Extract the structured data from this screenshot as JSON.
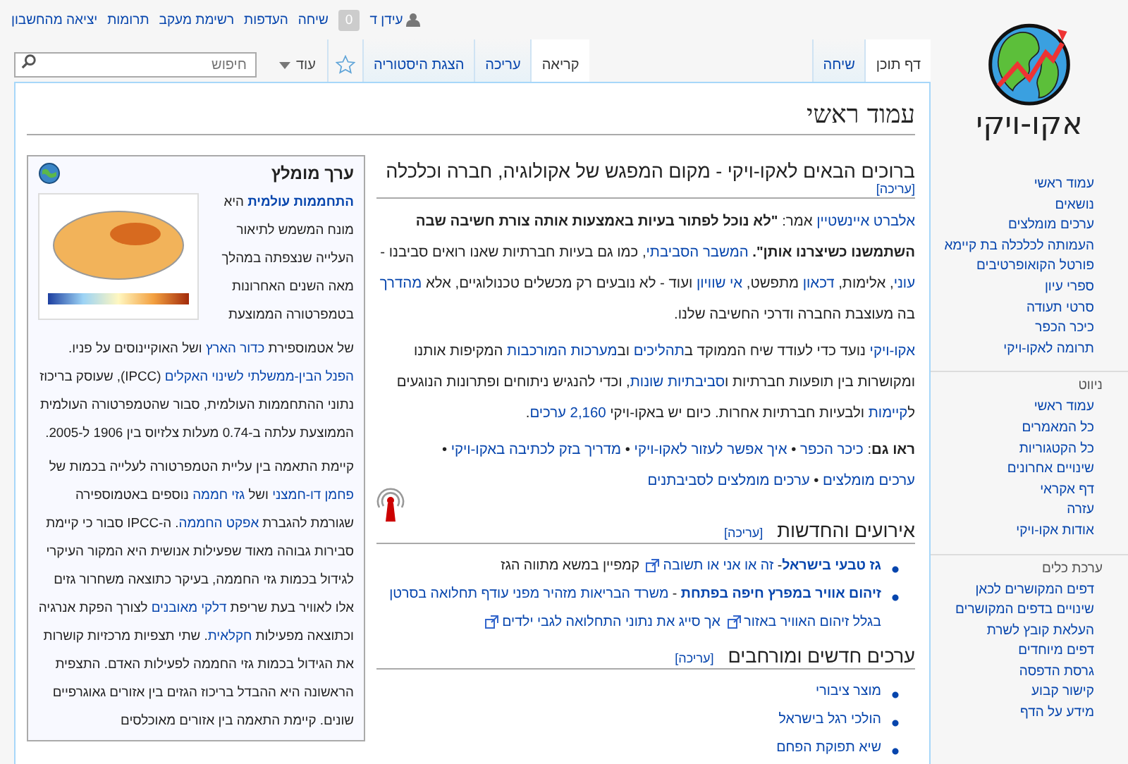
{
  "personal_bar": {
    "user": "עידן ד",
    "notifications": "0",
    "links": [
      "שיחה",
      "העדפות",
      "רשימת מעקב",
      "תרומות",
      "יציאה מהחשבון"
    ]
  },
  "logo": {
    "text": "אקו-ויקי"
  },
  "namespace_tabs": [
    {
      "label": "דף תוכן",
      "selected": true
    },
    {
      "label": "שיחה",
      "selected": false
    }
  ],
  "view_tabs": [
    {
      "label": "קריאה",
      "selected": true
    },
    {
      "label": "עריכה",
      "selected": false
    },
    {
      "label": "הצגת היסטוריה",
      "selected": false
    }
  ],
  "more_menu": "עוד",
  "search": {
    "placeholder": "חיפוש"
  },
  "sidebar": [
    {
      "items": [
        "עמוד ראשי",
        "נושאים",
        "ערכים מומלצים",
        "העמותה לכלכלה בת קיימא",
        "פורטל הקואופרטיבים",
        "ספרי עיון",
        "סרטי תעודה",
        "כיכר הכפר",
        "תרומה לאקו-ויקי"
      ]
    },
    {
      "heading": "ניווט",
      "items": [
        "עמוד ראשי",
        "כל המאמרים",
        "כל הקטגוריות",
        "שינויים אחרונים",
        "דף אקראי",
        "עזרה",
        "אודות אקו-ויקי"
      ]
    },
    {
      "heading": "ערכת כלים",
      "items": [
        "דפים המקושרים לכאן",
        "שינויים בדפים המקושרים",
        "העלאת קובץ לשרת",
        "דפים מיוחדים",
        "גרסת הדפסה",
        "קישור קבוע",
        "מידע על הדף"
      ]
    }
  ],
  "page_title": "עמוד ראשי",
  "sections": [
    {
      "kind": "intro",
      "heading": "ברוכים הבאים לאקו-ויקי - מקום המפגש של אקולוגיה, חברה וכלכלה",
      "edit": "[עריכה]",
      "paragraphs": [
        [
          {
            "text": "אלברט איינשטיין",
            "link": true
          },
          {
            "text": " אמר: "
          },
          {
            "text": "\"לא נוכל לפתור בעיות באמצעות אותה צורת חשיבה שבה השתמשנו כשיצרנו אותן\".",
            "bold": true
          },
          {
            "text": "המשבר הסביבתי",
            "link": true
          },
          {
            "text": ", כמו גם בעיות חברתיות שאנו רואים סביבנו - "
          },
          {
            "text": "עוני",
            "link": true
          },
          {
            "text": ", אלימות, "
          },
          {
            "text": "דכאון",
            "link": true
          },
          {
            "text": " מתפשט, "
          },
          {
            "text": "אי שוויון",
            "link": true
          },
          {
            "text": " ועוד - לא נובעים רק מכשלים טכנולוגיים, אלא "
          },
          {
            "text": "מהדרך",
            "link": true
          },
          {
            "text": " בה מעוצבת החברה ודרכי החשיבה שלנו."
          }
        ],
        [
          {
            "text": "אקו-ויקי",
            "link": true
          },
          {
            "text": " נועד כדי לעודד שיח הממוקד ב"
          },
          {
            "text": "תהליכים",
            "link": true
          },
          {
            "text": " וב"
          },
          {
            "text": "מערכות המורכבות",
            "link": true
          },
          {
            "text": " המקיפות אותנו ומקושרות בין תופעות חברתיות ו"
          },
          {
            "text": "סביבתיות שונות",
            "link": true
          },
          {
            "text": ", וכדי להנגיש ניתוחים ופתרונות הנוגעים ל"
          },
          {
            "text": "קיימות",
            "link": true
          },
          {
            "text": " ולבעיות חברתיות אחרות. כיום יש באקו-ויקי "
          },
          {
            "text": "2,160 ערכים",
            "link": true
          },
          {
            "text": "."
          }
        ],
        [
          {
            "text": "ראו גם",
            "bold": true
          },
          {
            "text": ": "
          },
          {
            "text": "כיכר הכפר",
            "link": true
          },
          {
            "text": " • "
          },
          {
            "text": "איך אפשר לעזור לאקו-ויקי",
            "link": true
          },
          {
            "text": " • "
          },
          {
            "text": "מדריך בזק לכתיבה באקו-ויקי",
            "link": true
          },
          {
            "text": " • "
          },
          {
            "text": "ערכים מומלצים",
            "link": true
          },
          {
            "text": " • "
          },
          {
            "text": "ערכים מומלצים לסביבתנים",
            "link": true
          }
        ]
      ]
    },
    {
      "kind": "news",
      "heading": "אירועים והחדשות",
      "edit": "[עריכה]",
      "bullets": [
        [
          {
            "text": "גז טבעי בישראל",
            "link": true,
            "bold": true
          },
          {
            "text": "- "
          },
          {
            "text": "זה או אני או תשובה",
            "link": true,
            "external": true
          },
          {
            "text": " קמפיין במשא מתווה הגז"
          }
        ],
        [
          {
            "text": "זיהום אוויר במפרץ חיפה בפתחת",
            "link": true,
            "bold": true
          },
          {
            "text": " - "
          },
          {
            "text": "משרד הבריאות מזהיר",
            "link": true
          },
          {
            "text": "מפני עודף תחלואה בסרטן",
            "link": true
          },
          {
            "text": "בגלל זיהום האוויר באזור",
            "link": true,
            "external": true
          },
          {
            "text": "אך סייג את נתוני התחלואה לגבי ילדים",
            "link": true,
            "external": true
          }
        ]
      ]
    },
    {
      "kind": "articles",
      "heading": "ערכים חדשים ומורחבים",
      "edit": "[עריכה]",
      "bullets": [
        [
          {
            "text": "מוצר ציבורי",
            "link": true
          }
        ],
        [
          {
            "text": "הולכי רגל בישראל",
            "link": true
          }
        ],
        [
          {
            "text": "שיא תפוקת הפחם",
            "link": true
          }
        ]
      ]
    }
  ],
  "featured": {
    "heading": "ערך מומלץ",
    "intro": [
      {
        "text": "התחממות עולמית",
        "link": true,
        "bold": true
      },
      {
        "text": " היא מונח המשמש לתיאור העלייה שנצפתה במהלך מאה השנים האחרונות בטמפרטורה הממוצעת"
      }
    ],
    "paragraphs": [
      [
        {
          "text": "של אטמוספירת "
        },
        {
          "text": "כדור הארץ",
          "link": true
        },
        {
          "text": " ושל האוקיינוסים על פניו. "
        },
        {
          "text": "הפנל הבין-ממשלתי לשינוי האקלים",
          "link": true
        },
        {
          "text": " (IPCC), שעוסק בריכוז נתוני ההתחממות העולמית, סבור שהטמפרטורה העולמית הממוצעת עלתה ב-0.74 מעלות צלזיוס בין 1906 ל-2005."
        }
      ],
      [
        {
          "text": "קיימת התאמה בין עליית הטמפרטורה לעלייה בכמות של "
        },
        {
          "text": "פחמן דו-חמצני",
          "link": true
        },
        {
          "text": " ושל "
        },
        {
          "text": "גזי חממה",
          "link": true
        },
        {
          "text": " נוספים באטמוספירה שגורמת להגברת "
        },
        {
          "text": "אפקט החממה",
          "link": true
        },
        {
          "text": ". ה-IPCC סבור כי קיימת סבירות גבוהה מאוד שפעילות אנושית היא המקור העיקרי לגידול בכמות גזי החממה, בעיקר כתוצאה משחרור גזים אלו לאוויר בעת שריפת "
        },
        {
          "text": "דלקי מאובנים",
          "link": true
        },
        {
          "text": " לצורך הפקת אנרגיה וכתוצאה מפעילות "
        },
        {
          "text": "חקלאית",
          "link": true
        },
        {
          "text": ". שתי תצפיות מרכזיות קושרות את הגידול בכמות גזי החממה לפעילות האדם. התצפית הראשונה היא ההבדל בריכוז הגזים בין אזורים גאוגרפיים שונים. קיימת התאמה בין אזורים מאוכלסים"
        }
      ]
    ]
  }
}
